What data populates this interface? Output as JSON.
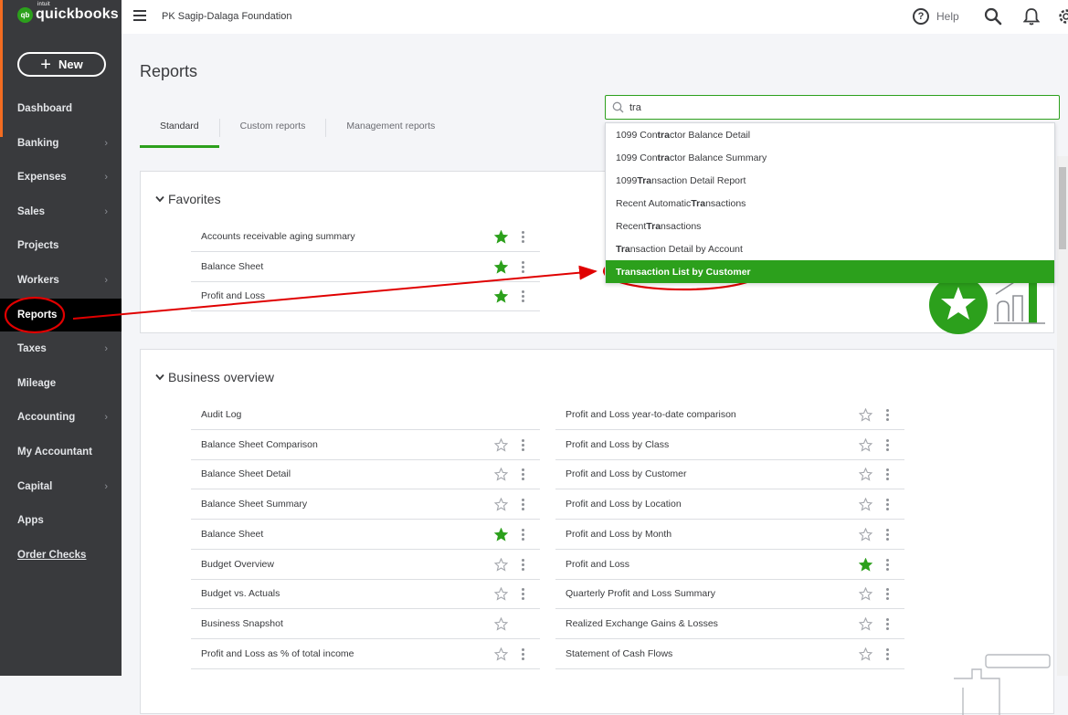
{
  "brand": {
    "mark": "qb",
    "sub": "intuit",
    "name": "quickbooks",
    "color": "#2ca01c"
  },
  "new_button": {
    "label": "New"
  },
  "sidebar": {
    "items": [
      {
        "label": "Dashboard",
        "chevron": false
      },
      {
        "label": "Banking",
        "chevron": true
      },
      {
        "label": "Expenses",
        "chevron": true
      },
      {
        "label": "Sales",
        "chevron": true
      },
      {
        "label": "Projects",
        "chevron": false
      },
      {
        "label": "Workers",
        "chevron": true
      },
      {
        "label": "Reports",
        "chevron": false,
        "active": true
      },
      {
        "label": "Taxes",
        "chevron": true
      },
      {
        "label": "Mileage",
        "chevron": false
      },
      {
        "label": "Accounting",
        "chevron": true
      },
      {
        "label": "My Accountant",
        "chevron": false
      },
      {
        "label": "Capital",
        "chevron": true
      },
      {
        "label": "Apps",
        "chevron": false
      },
      {
        "label": "Order Checks",
        "chevron": false
      }
    ]
  },
  "header": {
    "company": "PK Sagip-Dalaga Foundation",
    "help_label": "Help"
  },
  "page": {
    "title": "Reports"
  },
  "tabs": [
    {
      "label": "Standard",
      "active": true
    },
    {
      "label": "Custom reports",
      "active": false
    },
    {
      "label": "Management reports",
      "active": false
    }
  ],
  "search": {
    "value": "tra",
    "results": [
      {
        "pre": "1099 Con",
        "match": "tra",
        "post": "ctor Balance Detail"
      },
      {
        "pre": "1099 Con",
        "match": "tra",
        "post": "ctor Balance Summary"
      },
      {
        "pre": "1099 ",
        "match": "Tra",
        "post": "nsaction Detail Report"
      },
      {
        "pre": "Recent Automatic ",
        "match": "Tra",
        "post": "nsactions"
      },
      {
        "pre": "Recent ",
        "match": "Tra",
        "post": "nsactions"
      },
      {
        "pre": "",
        "match": "Tra",
        "post": "nsaction Detail by Account"
      },
      {
        "pre": "",
        "match": "Transaction List by Customer",
        "post": "",
        "active": true
      }
    ]
  },
  "favorites": {
    "title": "Favorites",
    "rows": [
      {
        "label": "Accounts receivable aging summary",
        "starred": true
      },
      {
        "label": "Balance Sheet",
        "starred": true
      },
      {
        "label": "Profit and Loss",
        "starred": true
      }
    ]
  },
  "business_overview": {
    "title": "Business overview",
    "left": [
      {
        "label": "Audit Log",
        "starred": false,
        "has_star": false
      },
      {
        "label": "Balance Sheet Comparison",
        "starred": false
      },
      {
        "label": "Balance Sheet Detail",
        "starred": false
      },
      {
        "label": "Balance Sheet Summary",
        "starred": false
      },
      {
        "label": "Balance Sheet",
        "starred": true
      },
      {
        "label": "Budget Overview",
        "starred": false
      },
      {
        "label": "Budget vs. Actuals",
        "starred": false
      },
      {
        "label": "Business Snapshot",
        "starred": false,
        "no_kebab": true
      },
      {
        "label": "Profit and Loss as % of total income",
        "starred": false
      }
    ],
    "right": [
      {
        "label": "Profit and Loss year-to-date comparison",
        "starred": false
      },
      {
        "label": "Profit and Loss by Class",
        "starred": false
      },
      {
        "label": "Profit and Loss by Customer",
        "starred": false
      },
      {
        "label": "Profit and Loss by Location",
        "starred": false
      },
      {
        "label": "Profit and Loss by Month",
        "starred": false
      },
      {
        "label": "Profit and Loss",
        "starred": true
      },
      {
        "label": "Quarterly Profit and Loss Summary",
        "starred": false
      },
      {
        "label": "Realized Exchange Gains & Losses",
        "starred": false
      },
      {
        "label": "Statement of Cash Flows",
        "starred": false
      }
    ]
  },
  "annotation": {
    "color": "#e00000"
  }
}
